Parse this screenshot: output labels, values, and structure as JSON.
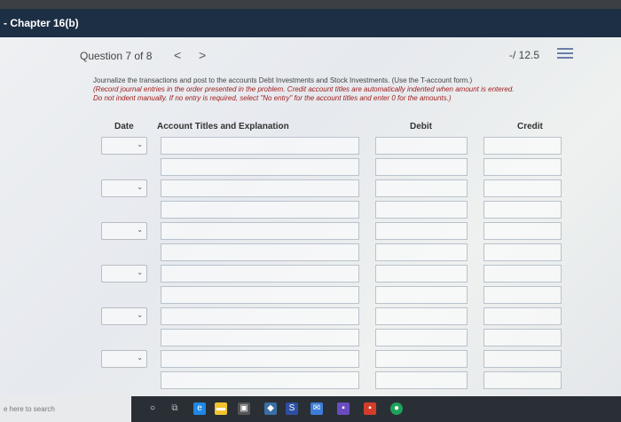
{
  "window": {
    "title": "- Chapter 16(b)"
  },
  "question": {
    "label": "Question 7 of 8",
    "prev_glyph": "<",
    "next_glyph": ">",
    "score": "-/ 12.5"
  },
  "instructions": {
    "line1": "Journalize the transactions and post to the accounts Debt Investments and Stock Investments. (Use the T-account form.)",
    "line2": "(Record journal entries in the order presented in the problem. Credit account titles are automatically indented when amount is entered.",
    "line3": "Do not indent manually. If no entry is required, select \"No entry\" for the account titles and enter 0 for the amounts.)"
  },
  "table": {
    "headers": {
      "date": "Date",
      "account": "Account Titles and Explanation",
      "debit": "Debit",
      "credit": "Credit"
    }
  },
  "taskbar": {
    "search_text": "e here to search"
  },
  "colors": {
    "titlebar": "#1d2f45",
    "instruction_red": "#a02020",
    "taskbar": "#2a2f36"
  }
}
